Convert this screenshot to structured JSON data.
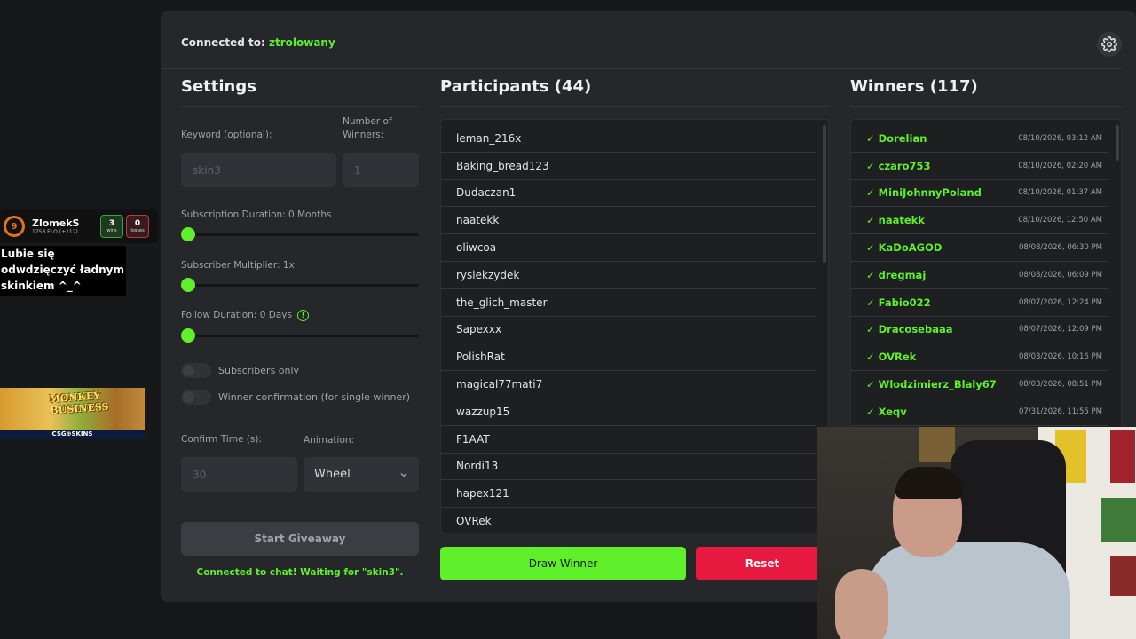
{
  "overlay": {
    "elo": {
      "level": "9",
      "name": "ZlomekS",
      "sub": "1758 ELO (+112)",
      "wins": "3",
      "wins_label": "wins",
      "losses": "0",
      "losses_label": "losses"
    },
    "chat_message": "Lubie się odwdzięczyć ładnym skinkiem ^_^",
    "promo": {
      "title_line1": "MONKEY",
      "title_line2": "BUSINESS",
      "bar": "CSG⊕SKINS"
    }
  },
  "header": {
    "connected_prefix": "Connected to: ",
    "connected_user": "ztrolowany"
  },
  "settings": {
    "title": "Settings",
    "keyword_label": "Keyword (optional):",
    "keyword_value": "skin3",
    "winners_label": "Number of Winners:",
    "winners_value": "1",
    "sub_duration_label": "Subscription Duration: 0 Months",
    "sub_duration_value": 0,
    "sub_multiplier_label": "Subscriber Multiplier: 1x",
    "sub_multiplier_value": 0,
    "follow_duration_label": "Follow Duration:  0  Days",
    "follow_duration_value": 0,
    "info_icon": "!",
    "subscribers_only_label": "Subscribers only",
    "subscribers_only": false,
    "winner_confirmation_label": "Winner confirmation (for single winner)",
    "winner_confirmation": false,
    "confirm_time_label": "Confirm Time (s):",
    "confirm_time_value": "30",
    "animation_label": "Animation:",
    "animation_value": "Wheel",
    "start_button": "Start Giveaway",
    "status": "Connected to chat! Waiting for \"skin3\"."
  },
  "participants": {
    "title": "Participants (44)",
    "items": [
      "leman_216x",
      "Baking_bread123",
      "Dudaczan1",
      "naatekk",
      "oliwcoa",
      "rysiekzydek",
      "the_glich_master",
      "Sapexxx",
      "PolishRat",
      "magical77mati7",
      "wazzup15",
      "F1AAT",
      "Nordi13",
      "hapex121",
      "OVRek"
    ],
    "draw_button": "Draw Winner",
    "reset_button": "Reset"
  },
  "winners": {
    "title": "Winners (117)",
    "items": [
      {
        "name": "✓ Dorelian",
        "date": "08/10/2026, 03:12 AM"
      },
      {
        "name": "✓ czaro753",
        "date": "08/10/2026, 02:20 AM"
      },
      {
        "name": "✓ MiniJohnnyPoland",
        "date": "08/10/2026, 01:37 AM"
      },
      {
        "name": "✓ naatekk",
        "date": "08/10/2026, 12:50 AM"
      },
      {
        "name": "✓ KaDoAGOD",
        "date": "08/08/2026, 06:30 PM"
      },
      {
        "name": "✓ dregmaj",
        "date": "08/08/2026, 06:09 PM"
      },
      {
        "name": "✓ Fabio022",
        "date": "08/07/2026, 12:24 PM"
      },
      {
        "name": "✓ Dracosebaaa",
        "date": "08/07/2026, 12:09 PM"
      },
      {
        "name": "✓ OVRek",
        "date": "08/03/2026, 10:16 PM"
      },
      {
        "name": "✓ Wlodzimierz_Blaly67",
        "date": "08/03/2026, 08:51 PM"
      },
      {
        "name": "✓ Xeqv",
        "date": "07/31/2026, 11:55 PM"
      }
    ]
  },
  "colors": {
    "accent": "#5ff02b",
    "danger": "#e8193f",
    "panel": "#25272a",
    "background": "#16181a"
  },
  "icons": {
    "settings": "gear-icon",
    "dropdown": "chevron-down-icon"
  }
}
